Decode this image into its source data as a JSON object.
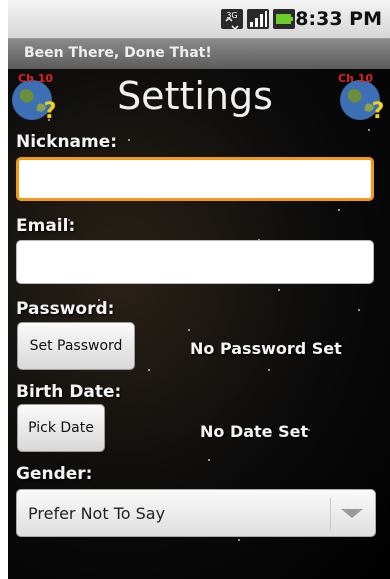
{
  "status_bar": {
    "time": "8:33 PM"
  },
  "app": {
    "title": "Been There, Done That!",
    "chapter_badge": "Ch 10"
  },
  "screen": {
    "heading": "Settings"
  },
  "form": {
    "nickname": {
      "label": "Nickname:",
      "value": ""
    },
    "email": {
      "label": "Email:",
      "value": ""
    },
    "password": {
      "label": "Password:",
      "button": "Set Password",
      "status": "No Password Set"
    },
    "birth_date": {
      "label": "Birth Date:",
      "button": "Pick Date",
      "status": "No Date Set"
    },
    "gender": {
      "label": "Gender:",
      "selected": "Prefer Not To Say"
    }
  },
  "icons": [
    "3g-icon",
    "signal-icon",
    "battery-icon",
    "earth-question-icon",
    "earth-question-icon",
    "chevron-down-icon"
  ],
  "colors": {
    "focus_border": "#f39a15",
    "title_bar": "#6e6e6e",
    "chapter_badge": "#e02020"
  }
}
